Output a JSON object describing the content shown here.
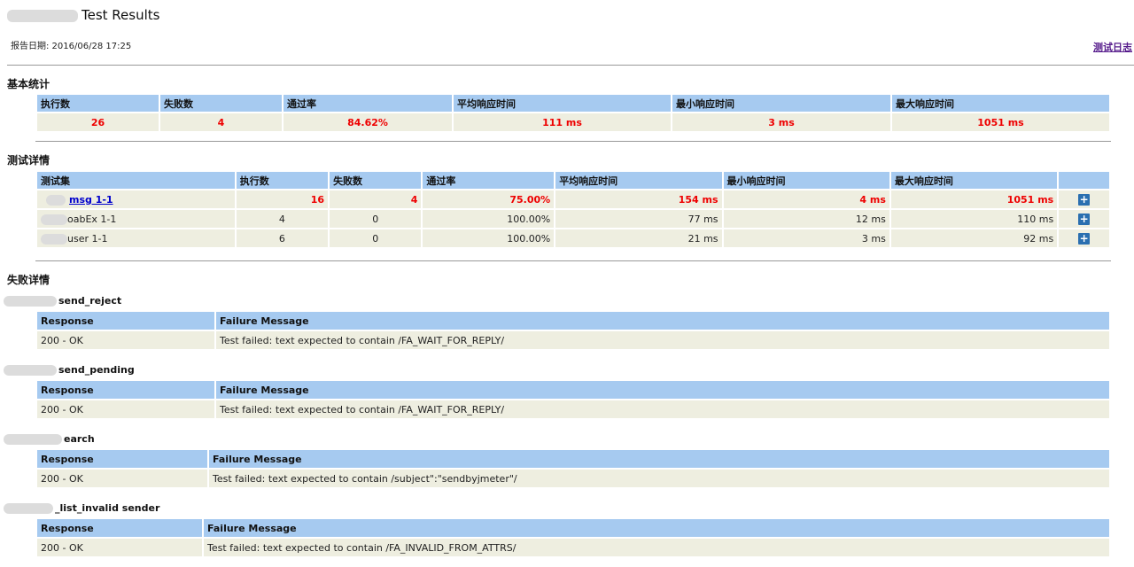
{
  "header": {
    "title": "Test Results",
    "date": "报告日期: 2016/06/28 17:25",
    "log_link": "测试日志"
  },
  "basic_stats": {
    "section_title": "基本统计",
    "columns": [
      "执行数",
      "失败数",
      "通过率",
      "平均响应时间",
      "最小响应时间",
      "最大响应时间"
    ],
    "values": [
      "26",
      "4",
      "84.62%",
      "111 ms",
      "3 ms",
      "1051 ms"
    ]
  },
  "test_details": {
    "section_title": "测试详情",
    "columns": [
      "测试集",
      "执行数",
      "失败数",
      "通过率",
      "平均响应时间",
      "最小响应时间",
      "最大响应时间"
    ],
    "rows": [
      [
        "msg 1-1",
        "16",
        "4",
        "75.00%",
        "154 ms",
        "4 ms",
        "1051 ms"
      ],
      [
        "oabEx 1-1",
        "4",
        "0",
        "100.00%",
        "77 ms",
        "12 ms",
        "110 ms"
      ],
      [
        "user 1-1",
        "6",
        "0",
        "100.00%",
        "21 ms",
        "3 ms",
        "92 ms"
      ]
    ],
    "expand_icon": "plus-square-icon"
  },
  "failures": {
    "section_title": "失败详情",
    "columns": [
      "Response",
      "Failure Message"
    ],
    "groups": [
      {
        "name": "send_reject",
        "response": "200 - OK",
        "message": "Test failed: text expected to contain /FA_WAIT_FOR_REPLY/"
      },
      {
        "name": "send_pending",
        "response": "200 - OK",
        "message": "Test failed: text expected to contain /FA_WAIT_FOR_REPLY/"
      },
      {
        "name": "earch",
        "response": "200 - OK",
        "message": "Test failed: text expected to contain /subject\":\"sendbyjmeter\"/"
      },
      {
        "name": "_list_invalid sender",
        "response": "200 - OK",
        "message": "Test failed: text expected to contain /FA_INVALID_FROM_ATTRS/"
      }
    ]
  },
  "colors": {
    "header_bg": "#a6caf0",
    "cell_bg": "#eeeee0",
    "fail_text": "#e00000",
    "link": "#0000cc",
    "visited_link": "#551a8b"
  }
}
